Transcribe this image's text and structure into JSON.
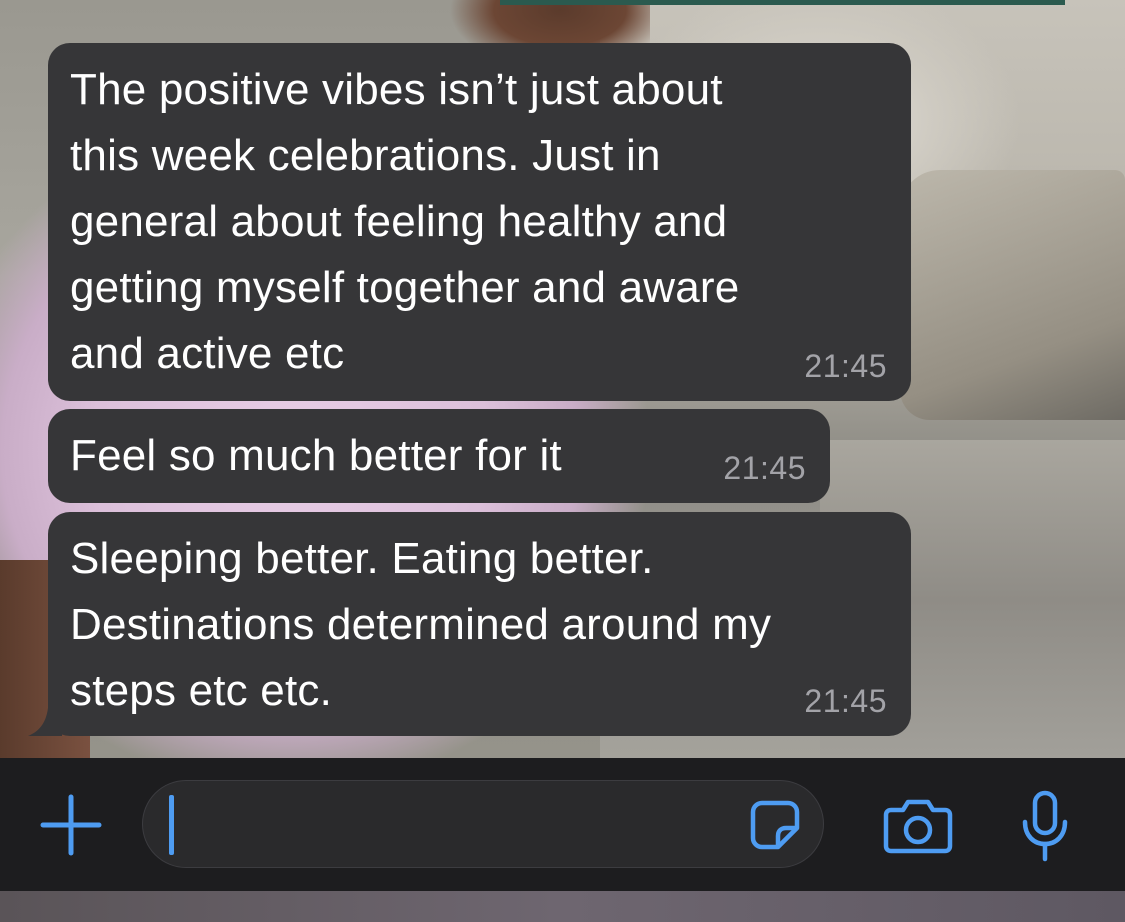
{
  "messages": [
    {
      "text": "The positive vibes isn’t just about\nthis week celebrations. Just in\ngeneral about feeling healthy and\ngetting myself together and aware\nand active etc",
      "time": "21:45"
    },
    {
      "text": "Feel so much better for it",
      "time": "21:45"
    },
    {
      "text": "Sleeping better. Eating better.\nDestinations determined around my\nsteps etc etc.",
      "time": "21:45"
    }
  ],
  "composer": {
    "message_value": "",
    "icons": {
      "attach": "plus-icon",
      "sticker": "sticker-icon",
      "camera": "camera-icon",
      "mic": "microphone-icon"
    }
  },
  "colors": {
    "accent": "#4e9cf2",
    "bubble": "#363638",
    "timestamp": "#a3a3a8",
    "bar": "#1d1d1f"
  }
}
